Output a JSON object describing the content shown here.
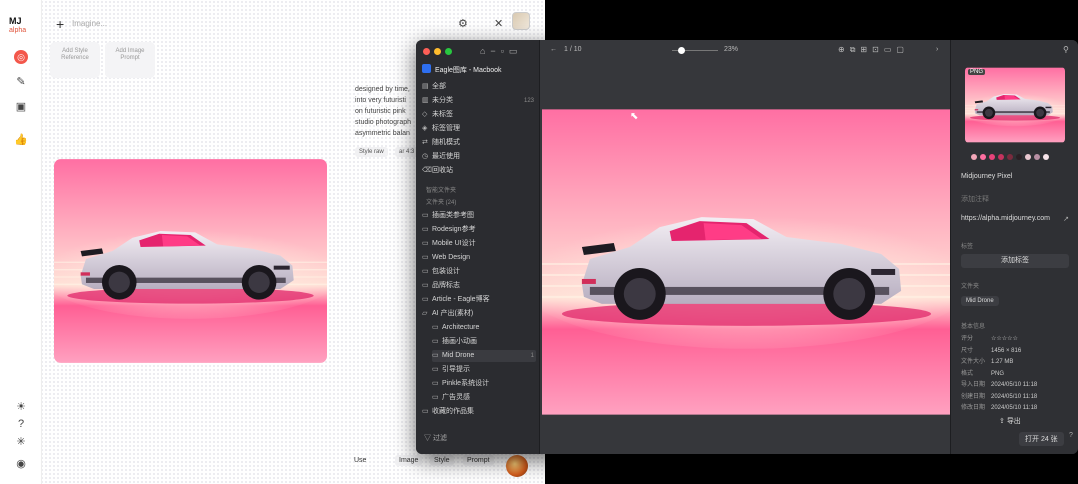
{
  "mj": {
    "logo": "MJ",
    "logo_sub": "alpha",
    "prompt_placeholder": "Imagine...",
    "add_style_reference": "Add Style Reference",
    "add_image_prompt": "Add Image Prompt",
    "description_lines": [
      "designed by time,",
      "into very futuristi",
      "on futuristic pink",
      "studio photograph",
      "asymmetric balan"
    ],
    "chips": [
      "Style raw",
      "ar 4:3"
    ],
    "bottom": {
      "use": "Use",
      "image": "Image",
      "style": "Style",
      "prompt": "Prompt"
    }
  },
  "eagle": {
    "library": "Eagle图库 - Macbook",
    "nav_items": [
      {
        "icon": "all",
        "label": "全部",
        "count": ""
      },
      {
        "icon": "unsorted",
        "label": "未分类",
        "count": "123"
      },
      {
        "icon": "untagged",
        "label": "未标签",
        "count": ""
      },
      {
        "icon": "tags",
        "label": "标签管理",
        "count": ""
      },
      {
        "icon": "random",
        "label": "随机模式",
        "count": ""
      },
      {
        "icon": "recent",
        "label": "最近使用",
        "count": ""
      },
      {
        "icon": "trash",
        "label": "回收站",
        "count": ""
      }
    ],
    "smart_head": "智能文件夹",
    "folder_head": "文件夹 (24)",
    "folders": [
      {
        "label": "插画类参考图",
        "count": "",
        "sub": false
      },
      {
        "label": "Rodesign参考",
        "count": "",
        "sub": false
      },
      {
        "label": "Mobile UI设计",
        "count": "",
        "sub": false
      },
      {
        "label": "Web Design",
        "count": "",
        "sub": false
      },
      {
        "label": "包装设计",
        "count": "",
        "sub": false
      },
      {
        "label": "品牌标志",
        "count": "",
        "sub": false
      },
      {
        "label": "Article - Eagle博客",
        "count": "",
        "sub": false
      },
      {
        "label": "AI 产出(素材)",
        "count": "",
        "sub": false
      },
      {
        "label": "Architecture",
        "count": "",
        "sub": true
      },
      {
        "label": "插画小动画",
        "count": "",
        "sub": true
      },
      {
        "label": "Mid Drone",
        "count": "1",
        "sub": true
      },
      {
        "label": "引导提示",
        "count": "",
        "sub": true
      },
      {
        "label": "Pinkle系统设计",
        "count": "",
        "sub": true
      },
      {
        "label": "广告灵感",
        "count": "",
        "sub": true
      },
      {
        "label": "收藏的作品集",
        "count": "",
        "sub": false
      }
    ],
    "filter_label": "过滤",
    "toolbar": {
      "counter": "1 / 10",
      "zoom": "23%"
    },
    "info": {
      "format_badge": "PNG",
      "name": "Midjourney Pixel",
      "note_placeholder": "添加注释",
      "url": "https://alpha.midjourney.com",
      "tags_label": "标签",
      "add_tag": "添加标签",
      "folder_label": "文件夹",
      "folder_value": "Mid Drone",
      "basic_label": "基本信息",
      "meta": [
        {
          "k": "评分",
          "v": "☆☆☆☆☆"
        },
        {
          "k": "尺寸",
          "v": "1456 × 816"
        },
        {
          "k": "文件大小",
          "v": "1.27 MB"
        },
        {
          "k": "格式",
          "v": "PNG"
        },
        {
          "k": "导入日期",
          "v": "2024/05/10 11:18"
        },
        {
          "k": "创建日期",
          "v": "2024/05/10 11:18"
        },
        {
          "k": "修改日期",
          "v": "2024/05/10 11:18"
        }
      ],
      "collect": "导出",
      "open_button": "打开 24 张",
      "help": "?"
    },
    "swatches": [
      "#f2a6b8",
      "#ff6fa0",
      "#e8437a",
      "#c4335e",
      "#7a2b3e",
      "#2a2024",
      "#e9c7d0",
      "#b88fa3",
      "#f7e4ea"
    ]
  }
}
